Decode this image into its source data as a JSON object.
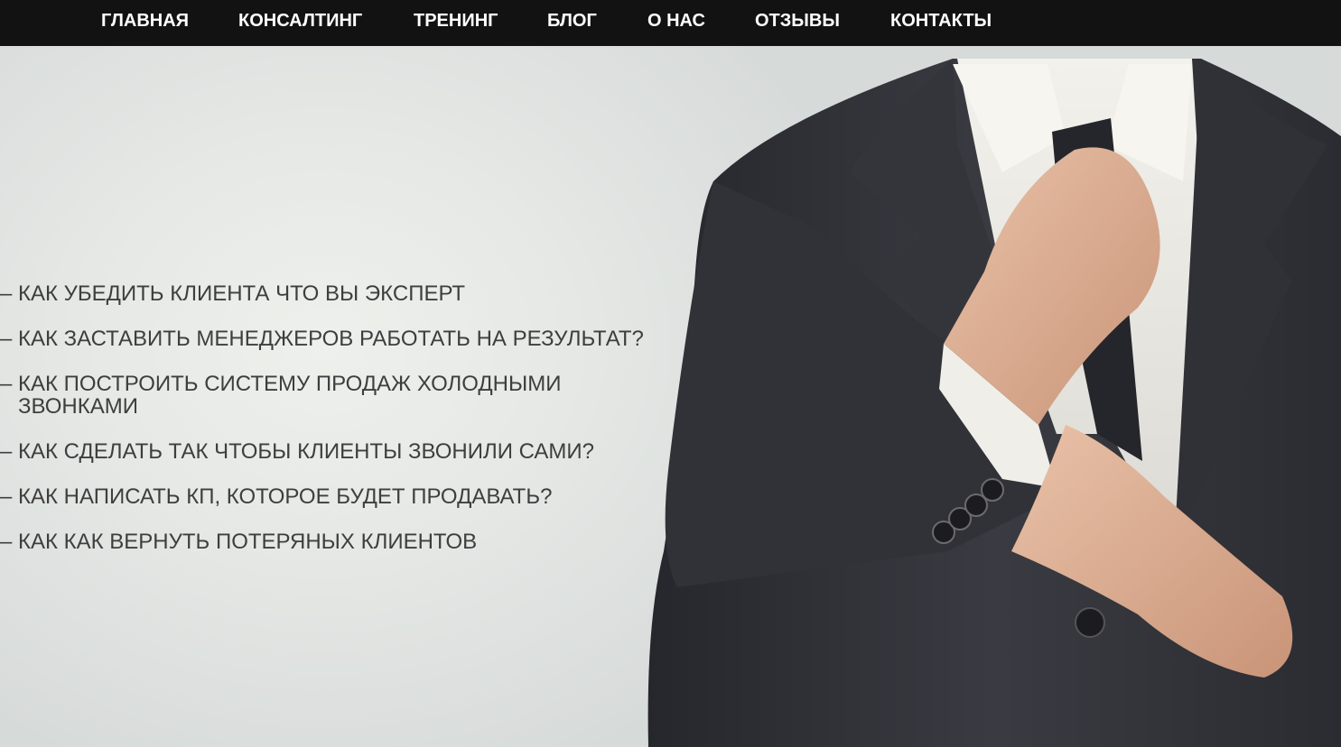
{
  "nav": {
    "items": [
      {
        "label": "ГЛАВНАЯ"
      },
      {
        "label": "КОНСАЛТИНГ"
      },
      {
        "label": "ТРЕНИНГ"
      },
      {
        "label": "БЛОГ"
      },
      {
        "label": "О НАС"
      },
      {
        "label": "ОТЗЫВЫ"
      },
      {
        "label": "КОНТАКТЫ"
      }
    ]
  },
  "hero": {
    "bullet": "–",
    "questions": [
      {
        "text": "КАК УБЕДИТЬ КЛИЕНТА ЧТО ВЫ ЭКСПЕРТ"
      },
      {
        "text": "КАК ЗАСТАВИТЬ МЕНЕДЖЕРОВ РАБОТАТЬ НА РЕЗУЛЬТАТ?"
      },
      {
        "text": "КАК ПОСТРОИТЬ СИСТЕМУ ПРОДАЖ ХОЛОДНЫМИ ЗВОНКАМИ"
      },
      {
        "text": "КАК СДЕЛАТЬ ТАК ЧТОБЫ КЛИЕНТЫ ЗВОНИЛИ САМИ?"
      },
      {
        "text": "КАК НАПИСАТЬ КП, КОТОРОЕ БУДЕТ ПРОДАВАТЬ?"
      },
      {
        "text": "КАК КАК ВЕРНУТЬ ПОТЕРЯНЫХ КЛИЕНТОВ"
      }
    ],
    "image": "businessman-adjusting-tie"
  },
  "colors": {
    "nav_bg": "#121212",
    "nav_text": "#ffffff",
    "question_text": "#3e3e3e",
    "suit": "#2c2d33",
    "shirt": "#ecebe6"
  }
}
